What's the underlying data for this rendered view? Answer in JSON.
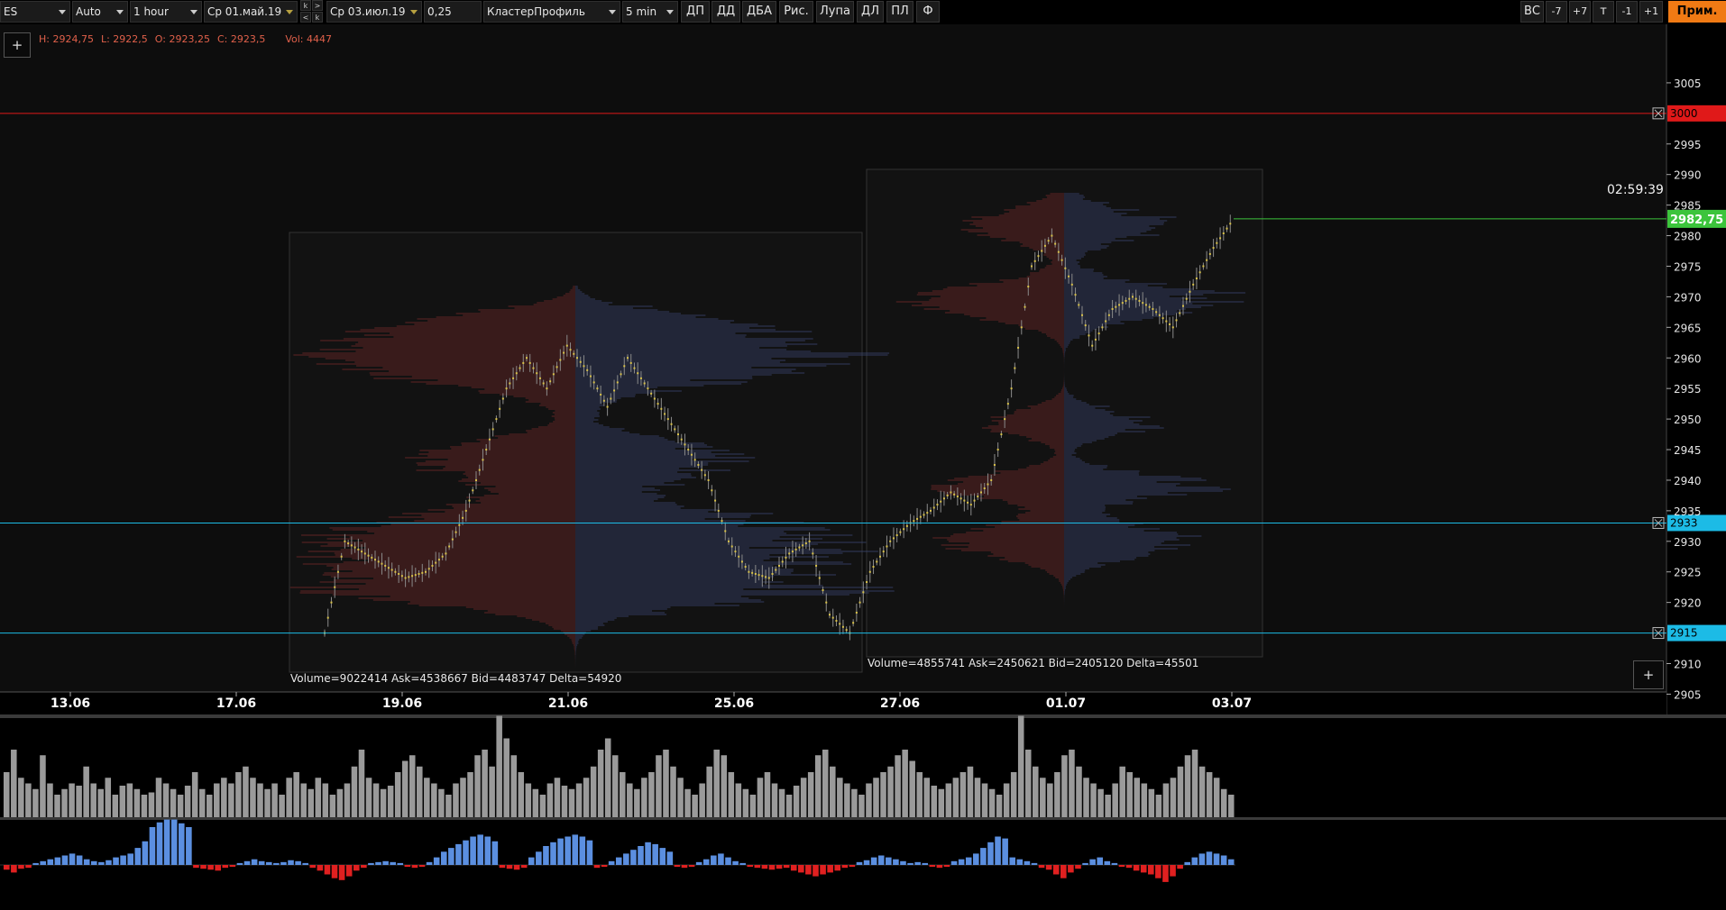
{
  "toolbar": {
    "symbol": "ES",
    "scale": "Auto",
    "timeframe": "1 hour",
    "date_from": "Ср 01.май.19",
    "date_to": "Ср 03.июл.19",
    "tick_size": "0,25",
    "chart_type": "КластерПрофиль",
    "profile_tf": "5 min",
    "nav_labels": [
      "k",
      "<",
      ">",
      "k"
    ],
    "buttons": [
      "ДП",
      "ДД",
      "ДБА",
      "Рис.",
      "Лупа",
      "ДЛ",
      "ПЛ",
      "Ф"
    ],
    "right_buttons": [
      "ВС",
      "-7",
      "+7",
      "т",
      "-1",
      "+1"
    ],
    "prim_label": "Прим."
  },
  "ohlc": {
    "high": "H: 2924,75",
    "low": "L: 2922,5",
    "open": "O: 2923,25",
    "close": "C: 2923,5",
    "vol": "Vol: 4447"
  },
  "plus_label": "+",
  "timer": "02:59:39",
  "price_axis": {
    "ticks": [
      "3005",
      "2995",
      "2990",
      "2985",
      "2980",
      "2975",
      "2970",
      "2965",
      "2960",
      "2955",
      "2950",
      "2945",
      "2940",
      "2935",
      "2930",
      "2925",
      "2920",
      "2910",
      "2905"
    ],
    "levels": [
      {
        "label": "3000",
        "price": 3000,
        "color": "#e01919"
      },
      {
        "label": "2933",
        "price": 2933,
        "color": "#1cbbe6"
      },
      {
        "label": "2915",
        "price": 2915,
        "color": "#1cbbe6"
      }
    ],
    "current": {
      "label": "2982,75",
      "price": 2982.75,
      "color": "#3cc43c"
    }
  },
  "date_axis": [
    "13.06",
    "17.06",
    "19.06",
    "21.06",
    "25.06",
    "27.06",
    "01.07",
    "03.07"
  ],
  "profiles": [
    {
      "stats": "Volume=9022414  Ask=4538667  Bid=4483747  Delta=54920"
    },
    {
      "stats": "Volume=4855741  Ask=2450621  Bid=2405120  Delta=45501"
    }
  ],
  "chart_data": {
    "type": "bar",
    "ylim": [
      2903,
      3010
    ],
    "y_ticks": [
      3005,
      2995,
      2990,
      2985,
      2980,
      2975,
      2970,
      2965,
      2960,
      2955,
      2950,
      2945,
      2940,
      2935,
      2930,
      2925,
      2920,
      2910,
      2905
    ],
    "x": [
      "13.06",
      "17.06",
      "19.06",
      "21.06",
      "25.06",
      "27.06",
      "01.07",
      "03.07"
    ],
    "horizontal_levels": [
      3000,
      2933,
      2915,
      2982.75
    ],
    "price_path": [
      2915,
      2930,
      2928,
      2926,
      2924,
      2925,
      2928,
      2935,
      2945,
      2955,
      2960,
      2955,
      2962,
      2958,
      2952,
      2960,
      2955,
      2950,
      2945,
      2940,
      2930,
      2925,
      2924,
      2928,
      2930,
      2918,
      2915,
      2925,
      2930,
      2933,
      2935,
      2938,
      2936,
      2940,
      2955,
      2975,
      2980,
      2972,
      2962,
      2968,
      2970,
      2968,
      2965,
      2972,
      2978,
      2982.75
    ],
    "volume": [
      40,
      60,
      35,
      30,
      25,
      55,
      30,
      20,
      25,
      30,
      28,
      45,
      30,
      25,
      35,
      20,
      28,
      30,
      25,
      20,
      22,
      35,
      30,
      25,
      20,
      28,
      40,
      25,
      20,
      30,
      35,
      30,
      40,
      45,
      35,
      30,
      25,
      30,
      20,
      35,
      40,
      30,
      25,
      35,
      30,
      20,
      25,
      30,
      45,
      60,
      35,
      30,
      25,
      28,
      40,
      50,
      55,
      45,
      35,
      30,
      25,
      20,
      30,
      35,
      40,
      55,
      60,
      45,
      90,
      70,
      55,
      40,
      30,
      25,
      20,
      30,
      35,
      28,
      25,
      30,
      35,
      45,
      60,
      70,
      55,
      40,
      30,
      25,
      35,
      40,
      55,
      60,
      45,
      35,
      25,
      20,
      30,
      45,
      60,
      55,
      40,
      30,
      25,
      20,
      35,
      40,
      30,
      25,
      20,
      28,
      35,
      40,
      55,
      60,
      45,
      35,
      30,
      25,
      20,
      30,
      35,
      40,
      45,
      55,
      60,
      50,
      40,
      35,
      28,
      25,
      30,
      35,
      40,
      45,
      35,
      30,
      25,
      20,
      30,
      40,
      90,
      60,
      45,
      35,
      30,
      40,
      55,
      60,
      45,
      35,
      30,
      25,
      20,
      30,
      45,
      40,
      35,
      30,
      25,
      20,
      30,
      35,
      45,
      55,
      60,
      45,
      40,
      35,
      25,
      20
    ],
    "delta": [
      -5,
      -8,
      -4,
      -3,
      2,
      4,
      6,
      8,
      10,
      12,
      10,
      6,
      4,
      3,
      5,
      8,
      10,
      12,
      18,
      25,
      40,
      45,
      48,
      48,
      44,
      40,
      -3,
      -4,
      -5,
      -6,
      -3,
      -2,
      2,
      4,
      6,
      4,
      3,
      2,
      3,
      5,
      4,
      2,
      -3,
      -6,
      -10,
      -14,
      -16,
      -12,
      -6,
      -3,
      2,
      3,
      4,
      3,
      2,
      -2,
      -3,
      -2,
      3,
      8,
      14,
      18,
      22,
      26,
      30,
      32,
      30,
      25,
      -3,
      -4,
      -5,
      -3,
      8,
      14,
      20,
      24,
      28,
      30,
      32,
      30,
      26,
      -3,
      -2,
      4,
      8,
      12,
      16,
      20,
      24,
      22,
      18,
      14,
      -2,
      -3,
      -2,
      3,
      6,
      10,
      12,
      8,
      4,
      2,
      -2,
      -3,
      -4,
      -5,
      -4,
      -3,
      -6,
      -8,
      -10,
      -12,
      -10,
      -8,
      -6,
      -3,
      -2,
      3,
      5,
      8,
      10,
      8,
      6,
      4,
      2,
      3,
      2,
      -2,
      -3,
      -2,
      4,
      6,
      8,
      12,
      18,
      24,
      30,
      28,
      8,
      6,
      4,
      2,
      -3,
      -5,
      -10,
      -14,
      -8,
      -4,
      2,
      6,
      8,
      4,
      2,
      -2,
      -3,
      -6,
      -8,
      -10,
      -14,
      -18,
      -12,
      -4,
      3,
      8,
      12,
      14,
      12,
      10,
      6
    ]
  }
}
